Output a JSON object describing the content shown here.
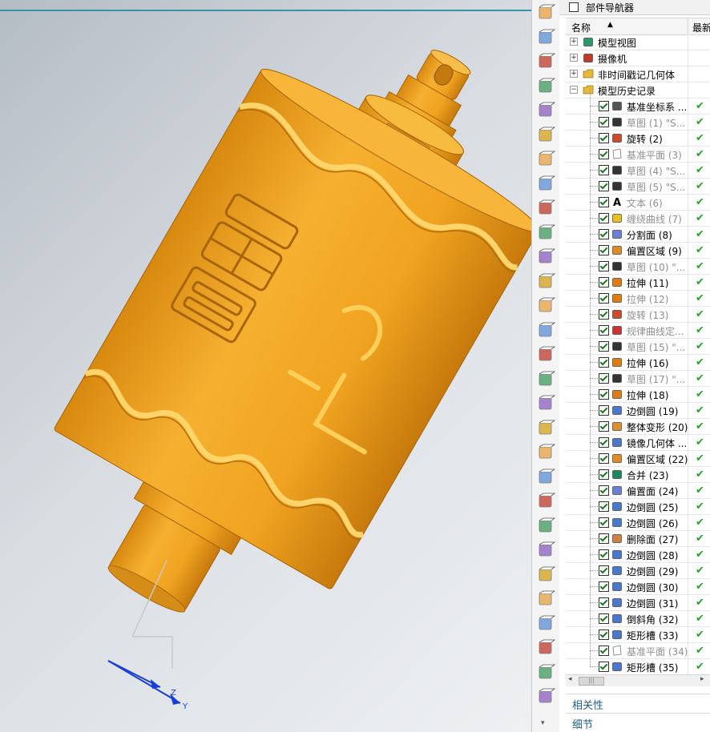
{
  "navigator": {
    "title": "部件导航器",
    "columns": {
      "name": "名称",
      "sort_arrow": "▲",
      "latest": "最新"
    },
    "top_items": [
      {
        "label": "模型视图",
        "expander": "+",
        "icon": "model-views-icon"
      },
      {
        "label": "摄像机",
        "expander": "+",
        "icon": "camera-icon"
      },
      {
        "label": "非时间戳记几何体",
        "expander": "+",
        "icon": "folder-icon"
      },
      {
        "label": "模型历史记录",
        "expander": "−",
        "icon": "folder-open-icon"
      }
    ],
    "features": [
      {
        "label": "基准坐标系 ...",
        "icon": "datum-csys-icon",
        "grayed": false
      },
      {
        "label": "草图 (1) \"S...",
        "icon": "sketch-icon",
        "grayed": true
      },
      {
        "label": "旋转 (2)",
        "icon": "revolve-icon",
        "grayed": false
      },
      {
        "label": "基准平面 (3)",
        "icon": "datum-plane-icon",
        "grayed": true
      },
      {
        "label": "草图 (4) \"S...",
        "icon": "sketch-icon",
        "grayed": true
      },
      {
        "label": "草图 (5) \"S...",
        "icon": "sketch-icon",
        "grayed": true
      },
      {
        "label": "文本 (6)",
        "icon": "text-icon",
        "grayed": true
      },
      {
        "label": "缠绕曲线 (7)",
        "icon": "wrap-curve-icon",
        "grayed": true
      },
      {
        "label": "分割面 (8)",
        "icon": "divide-face-icon",
        "grayed": false
      },
      {
        "label": "偏置区域 (9)",
        "icon": "offset-region-icon",
        "grayed": false
      },
      {
        "label": "草图 (10) \"...",
        "icon": "sketch-icon",
        "grayed": true
      },
      {
        "label": "拉伸 (11)",
        "icon": "extrude-icon",
        "grayed": false
      },
      {
        "label": "拉伸 (12)",
        "icon": "extrude-icon",
        "grayed": true
      },
      {
        "label": "旋转 (13)",
        "icon": "revolve-icon",
        "grayed": true
      },
      {
        "label": "规律曲线定...",
        "icon": "law-curve-icon",
        "grayed": true
      },
      {
        "label": "草图 (15) \"...",
        "icon": "sketch-icon",
        "grayed": true
      },
      {
        "label": "拉伸 (16)",
        "icon": "extrude-icon",
        "grayed": false
      },
      {
        "label": "草图 (17) \"...",
        "icon": "sketch-icon",
        "grayed": true
      },
      {
        "label": "拉伸 (18)",
        "icon": "extrude-icon",
        "grayed": false
      },
      {
        "label": "边倒圆 (19)",
        "icon": "edge-blend-icon",
        "grayed": false
      },
      {
        "label": "整体变形 (20)",
        "icon": "global-shaping-icon",
        "grayed": false
      },
      {
        "label": "镜像几何体 ...",
        "icon": "mirror-geometry-icon",
        "grayed": false
      },
      {
        "label": "偏置区域 (22)",
        "icon": "offset-region-icon",
        "grayed": false
      },
      {
        "label": "合并 (23)",
        "icon": "unite-icon",
        "grayed": false
      },
      {
        "label": "偏置面 (24)",
        "icon": "offset-face-icon",
        "grayed": false
      },
      {
        "label": "边倒圆 (25)",
        "icon": "edge-blend-icon",
        "grayed": false
      },
      {
        "label": "边倒圆 (26)",
        "icon": "edge-blend-icon",
        "grayed": false
      },
      {
        "label": "删除面 (27)",
        "icon": "delete-face-icon",
        "grayed": false
      },
      {
        "label": "边倒圆 (28)",
        "icon": "edge-blend-icon",
        "grayed": false
      },
      {
        "label": "边倒圆 (29)",
        "icon": "edge-blend-icon",
        "grayed": false
      },
      {
        "label": "边倒圆 (30)",
        "icon": "edge-blend-icon",
        "grayed": false
      },
      {
        "label": "边倒圆 (31)",
        "icon": "edge-blend-icon",
        "grayed": false
      },
      {
        "label": "倒斜角 (32)",
        "icon": "chamfer-icon",
        "grayed": false
      },
      {
        "label": "矩形槽 (33)",
        "icon": "rect-groove-icon",
        "grayed": false
      },
      {
        "label": "基准平面 (34)",
        "icon": "datum-plane-icon",
        "grayed": true
      },
      {
        "label": "矩形槽 (35)",
        "icon": "rect-groove-icon",
        "grayed": false
      }
    ],
    "scroll": {
      "left": "◂",
      "thumb": "|||",
      "right": "▸"
    },
    "panels": {
      "dependencies": "相关性",
      "details": "细节"
    }
  },
  "viewport": {
    "triad_labels": {
      "z": "Z",
      "y": "Y"
    },
    "model_color": "#f0a526"
  },
  "resource_bar": {
    "icons": [
      "select-box-icon",
      "measure-ruler-icon",
      "angle-icon",
      "circle-dim-icon",
      "arc-icon",
      "radius-icon",
      "comb-icon",
      "surface-icon",
      "sheet-icon",
      "offset-icon",
      "cross-icon",
      "block-icon",
      "block-icon",
      "block-icon",
      "block-icon",
      "block-icon",
      "block-icon",
      "cylinder-icon",
      "block-icon",
      "block-icon",
      "block-icon",
      "block-icon",
      "block-icon",
      "block-icon",
      "block-icon",
      "cylinder-icon",
      "block-icon",
      "block-icon",
      "block-icon"
    ],
    "more": "▾"
  }
}
